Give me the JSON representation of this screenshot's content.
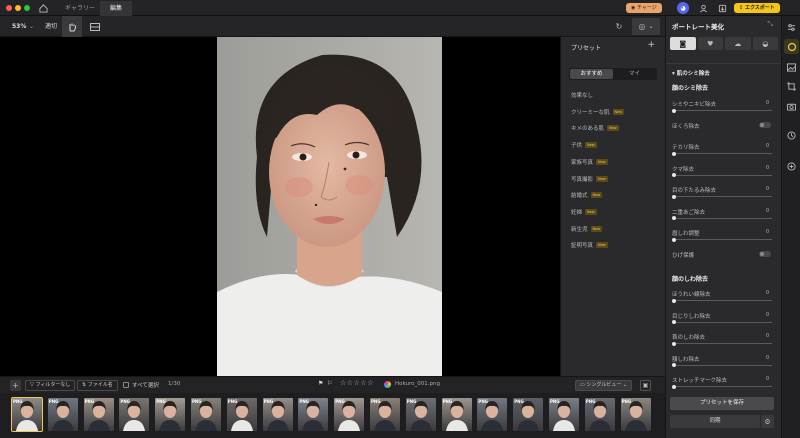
{
  "titlebar": {
    "tabs": [
      "ギャラリー",
      "編集"
    ],
    "charge_label": "チャージ",
    "export_label": "エクスポート"
  },
  "toolbar": {
    "zoom": "53%",
    "fit_label": "適切"
  },
  "presets": {
    "title": "プリセット",
    "add_label": "+",
    "tabs": [
      "おすすめ",
      "マイ"
    ],
    "items": [
      {
        "label": "効果なし",
        "new": false
      },
      {
        "label": "クリーミーな肌",
        "new": true
      },
      {
        "label": "キメのある肌",
        "new": true
      },
      {
        "label": "子供",
        "new": true
      },
      {
        "label": "家族写真",
        "new": true
      },
      {
        "label": "写真撮影",
        "new": true
      },
      {
        "label": "結婚式",
        "new": true
      },
      {
        "label": "妊婦",
        "new": true
      },
      {
        "label": "新生児",
        "new": true
      },
      {
        "label": "証明写真",
        "new": true
      }
    ],
    "new_badge": "New"
  },
  "panel": {
    "title": "ポートレート美化",
    "section": "肌のシミ除去",
    "group1_title": "顔のシミ除去",
    "group1": [
      {
        "label": "シミやニキビ除去",
        "value": "0",
        "type": "slider"
      },
      {
        "label": "ほくろ除去",
        "value": "",
        "type": "toggle"
      },
      {
        "label": "テカリ除去",
        "value": "0",
        "type": "slider"
      },
      {
        "label": "クマ除去",
        "value": "0",
        "type": "slider"
      },
      {
        "label": "目の下たるみ除去",
        "value": "0",
        "type": "slider"
      },
      {
        "label": "二重あご除去",
        "value": "0",
        "type": "slider"
      },
      {
        "label": "眉しわ調整",
        "value": "0",
        "type": "slider"
      },
      {
        "label": "ひげ保護",
        "value": "",
        "type": "toggle"
      }
    ],
    "group2_title": "顔のしわ除去",
    "group2": [
      {
        "label": "ほうれい線除去",
        "value": "0"
      },
      {
        "label": "目じりしわ除去",
        "value": "0"
      },
      {
        "label": "首のしわ除去",
        "value": "0"
      },
      {
        "label": "額しわ除去",
        "value": "0"
      },
      {
        "label": "ストレッチマーク除去",
        "value": "0"
      }
    ],
    "save_preset_label": "プリセットを保存",
    "sync_label": "同期"
  },
  "filmbar": {
    "filter_label": "フィルターなし",
    "filename_label": "ファイル名",
    "select_all_label": "すべて選択",
    "count": "1/30",
    "rating": "☆☆☆☆☆",
    "current_file": "Hokuro_001.png",
    "view_label": "シングルビュー"
  },
  "thumbnails": {
    "badge": "PNG",
    "count": 18
  },
  "colors": {
    "accent": "#f0c84a",
    "export": "#f5c518",
    "charge": "#f3b27a"
  }
}
